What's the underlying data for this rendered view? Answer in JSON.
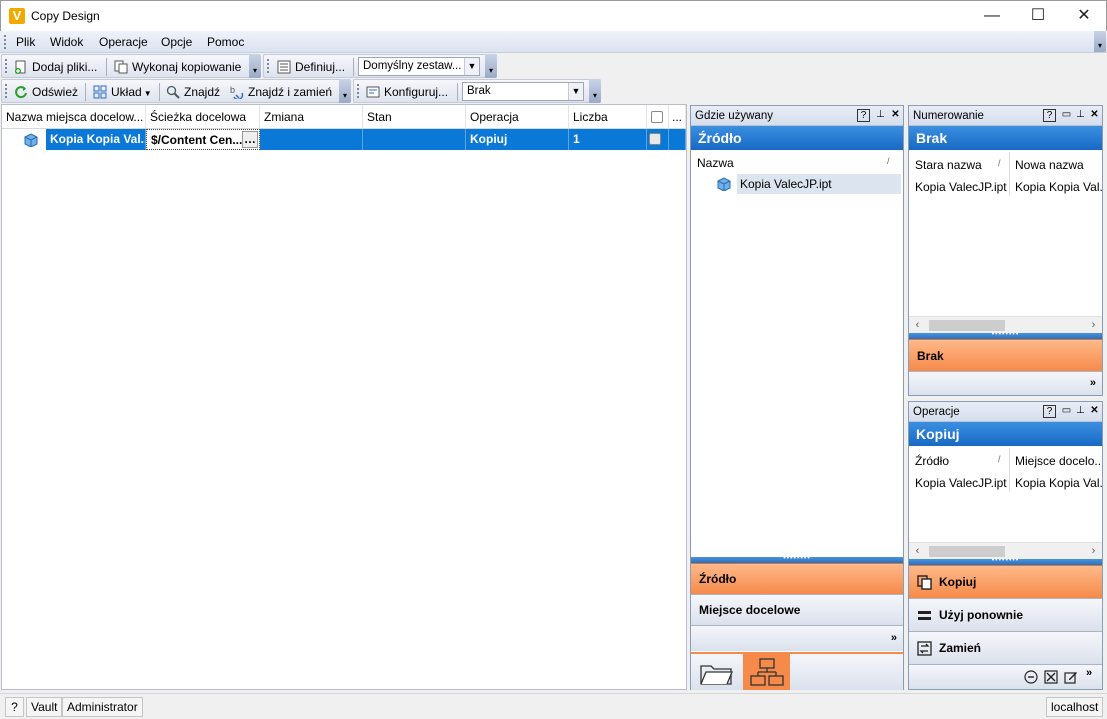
{
  "window": {
    "title": "Copy Design",
    "app_icon_letter": "V",
    "minimize": "—",
    "maximize": "☐",
    "close": "✕"
  },
  "menu": [
    "Plik",
    "Widok",
    "Operacje",
    "Opcje",
    "Pomoc"
  ],
  "toolbar1": {
    "add_files": "Dodaj pliki...",
    "run_copy": "Wykonaj kopiowanie",
    "define": "Definiuj...",
    "preset_value": "Domyślny zestaw..."
  },
  "toolbar2": {
    "refresh": "Odśwież",
    "layout": "Układ",
    "find": "Znajdź",
    "find_replace": "Znajdź i zamień",
    "configure": "Konfiguruj...",
    "filter_value": "Brak"
  },
  "grid": {
    "columns": [
      "Nazwa miejsca docelow...",
      "Ścieżka docelowa",
      "Zmiana",
      "Stan",
      "Operacja",
      "Liczba",
      "",
      "..."
    ],
    "row": {
      "name": "Kopia Kopia Val...",
      "path": "$/Content Cen...",
      "path_button": "…",
      "change": "",
      "state": "",
      "operation": "Kopiuj",
      "count": "1"
    }
  },
  "where_used": {
    "title": "Gdzie używany",
    "header": "Źródło",
    "column": "Nazwa",
    "item": "Kopia ValecJP.ipt",
    "btn_source": "Źródło",
    "btn_destination": "Miejsce docelowe"
  },
  "numbering": {
    "title": "Numerowanie",
    "header": "Brak",
    "col_old": "Stara nazwa",
    "col_new": "Nowa nazwa",
    "row_old": "Kopia ValecJP.ipt",
    "row_new": "Kopia Kopia Val...",
    "btn_none": "Brak"
  },
  "operations": {
    "title": "Operacje",
    "header": "Kopiuj",
    "col_source": "Źródło",
    "col_dest": "Miejsce docelo...",
    "row_source": "Kopia ValecJP.ipt",
    "row_dest": "Kopia Kopia Val...",
    "btn_copy": "Kopiuj",
    "btn_reuse": "Użyj ponownie",
    "btn_replace": "Zamień"
  },
  "status": {
    "help": "?",
    "vault": "Vault",
    "user": "Administrator",
    "server": "localhost"
  },
  "colors": {
    "selection": "#0a78d7",
    "accent_orange": "#f58a4a",
    "panel_header_blue": "#1769c4"
  }
}
